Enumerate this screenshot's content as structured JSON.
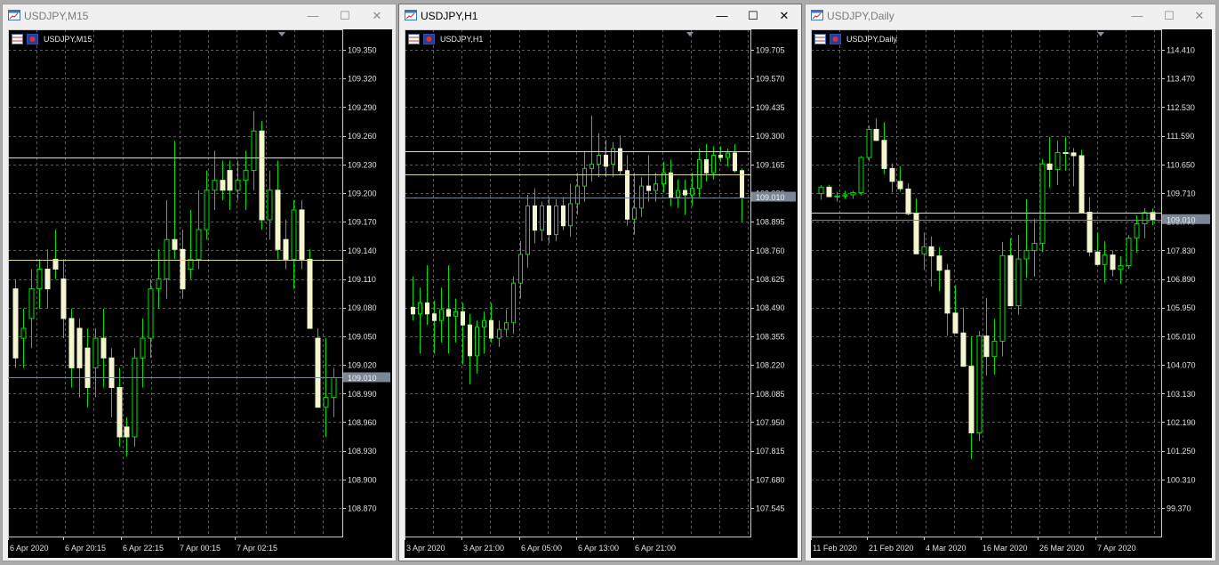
{
  "windows": [
    {
      "title": "USDJPY,M15",
      "label": "USDJPY,M15",
      "controls": {
        "minimize": "—",
        "maximize": "☐",
        "close": "✕"
      },
      "current_price": "109.010",
      "chart_data": {
        "type": "candlestick",
        "symbol": "USDJPY",
        "timeframe": "M15",
        "y_ticks": [
          "109.350",
          "109.320",
          "109.290",
          "109.260",
          "109.230",
          "109.200",
          "109.170",
          "109.140",
          "109.110",
          "109.080",
          "109.050",
          "109.020",
          "108.990",
          "108.960",
          "108.930",
          "108.900",
          "108.870"
        ],
        "x_labels": [
          "6 Apr 2020",
          "6 Apr 20:15",
          "6 Apr 22:15",
          "7 Apr 00:15",
          "7 Apr 02:15"
        ],
        "ylim": [
          108.849,
          109.363
        ],
        "hlines": [
          109.233,
          109.129,
          109.01
        ],
        "grid": true,
        "candles": [
          [
            109.1,
            109.11,
            109.02,
            109.03
          ],
          [
            109.05,
            109.08,
            109.02,
            109.06
          ],
          [
            109.07,
            109.12,
            109.04,
            109.1
          ],
          [
            109.1,
            109.13,
            109.08,
            109.12
          ],
          [
            109.12,
            109.14,
            109.08,
            109.1
          ],
          [
            109.13,
            109.16,
            109.11,
            109.12
          ],
          [
            109.11,
            109.13,
            109.05,
            109.07
          ],
          [
            109.07,
            109.08,
            109.0,
            109.02
          ],
          [
            109.06,
            109.07,
            108.99,
            109.02
          ],
          [
            109.04,
            109.06,
            108.98,
            109.0
          ],
          [
            109.02,
            109.06,
            108.99,
            109.05
          ],
          [
            109.05,
            109.08,
            109.0,
            109.03
          ],
          [
            109.03,
            109.04,
            108.97,
            109.0
          ],
          [
            109.0,
            109.02,
            108.94,
            108.95
          ],
          [
            108.96,
            108.97,
            108.93,
            108.95
          ],
          [
            108.95,
            109.04,
            108.94,
            109.03
          ],
          [
            109.03,
            109.07,
            109.0,
            109.05
          ],
          [
            109.05,
            109.11,
            109.03,
            109.1
          ],
          [
            109.1,
            109.14,
            109.08,
            109.11
          ],
          [
            109.11,
            109.19,
            109.09,
            109.15
          ],
          [
            109.15,
            109.25,
            109.13,
            109.14
          ],
          [
            109.14,
            109.16,
            109.09,
            109.1
          ],
          [
            109.12,
            109.18,
            109.11,
            109.13
          ],
          [
            109.13,
            109.2,
            109.12,
            109.16
          ],
          [
            109.16,
            109.22,
            109.15,
            109.2
          ],
          [
            109.2,
            109.24,
            109.18,
            109.21
          ],
          [
            109.21,
            109.23,
            109.19,
            109.2
          ],
          [
            109.22,
            109.23,
            109.18,
            109.2
          ],
          [
            109.2,
            109.23,
            109.19,
            109.21
          ],
          [
            109.21,
            109.24,
            109.18,
            109.22
          ],
          [
            109.22,
            109.28,
            109.2,
            109.26
          ],
          [
            109.26,
            109.27,
            109.16,
            109.17
          ],
          [
            109.17,
            109.22,
            109.15,
            109.2
          ],
          [
            109.2,
            109.23,
            109.13,
            109.14
          ],
          [
            109.15,
            109.17,
            109.12,
            109.13
          ],
          [
            109.13,
            109.19,
            109.1,
            109.18
          ],
          [
            109.18,
            109.19,
            109.12,
            109.13
          ],
          [
            109.13,
            109.14,
            109.06,
            109.06
          ],
          [
            109.05,
            109.06,
            108.98,
            108.98
          ],
          [
            108.98,
            109.05,
            108.95,
            108.99
          ],
          [
            108.99,
            109.02,
            108.97,
            109.01
          ]
        ]
      }
    },
    {
      "title": "USDJPY,H1",
      "label": "USDJPY,H1",
      "controls": {
        "minimize": "—",
        "maximize": "☐",
        "close": "✕"
      },
      "current_price": "109.010",
      "chart_data": {
        "type": "candlestick",
        "symbol": "USDJPY",
        "timeframe": "H1",
        "y_ticks": [
          "109.705",
          "109.570",
          "109.435",
          "109.300",
          "109.165",
          "109.030",
          "108.895",
          "108.760",
          "108.625",
          "108.490",
          "108.355",
          "108.220",
          "108.085",
          "107.950",
          "107.815",
          "107.680",
          "107.545"
        ],
        "x_labels": [
          "3 Apr 2020",
          "3 Apr 21:00",
          "6 Apr 05:00",
          "6 Apr 13:00",
          "6 Apr 21:00"
        ],
        "ylim": [
          107.47,
          109.771
        ],
        "hlines": [
          109.219,
          109.114,
          109.01
        ],
        "grid": true,
        "candles": [
          [
            108.51,
            108.65,
            108.45,
            108.48
          ],
          [
            108.48,
            108.6,
            108.3,
            108.53
          ],
          [
            108.53,
            108.7,
            108.43,
            108.48
          ],
          [
            108.48,
            108.54,
            108.3,
            108.45
          ],
          [
            108.45,
            108.6,
            108.35,
            108.5
          ],
          [
            108.5,
            108.7,
            108.3,
            108.47
          ],
          [
            108.47,
            108.55,
            108.35,
            108.49
          ],
          [
            108.49,
            108.53,
            108.25,
            108.43
          ],
          [
            108.43,
            108.48,
            108.16,
            108.29
          ],
          [
            108.29,
            108.45,
            108.21,
            108.42
          ],
          [
            108.42,
            108.49,
            108.3,
            108.45
          ],
          [
            108.45,
            108.53,
            108.35,
            108.37
          ],
          [
            108.37,
            108.45,
            108.33,
            108.41
          ],
          [
            108.41,
            108.5,
            108.38,
            108.44
          ],
          [
            108.44,
            108.65,
            108.39,
            108.62
          ],
          [
            108.62,
            108.81,
            108.55,
            108.75
          ],
          [
            108.75,
            109.02,
            108.69,
            108.97
          ],
          [
            108.97,
            109.05,
            108.8,
            108.86
          ],
          [
            108.86,
            108.99,
            108.81,
            108.97
          ],
          [
            108.97,
            109.01,
            108.8,
            108.84
          ],
          [
            108.84,
            109.0,
            108.81,
            108.97
          ],
          [
            108.97,
            109.01,
            108.86,
            108.88
          ],
          [
            108.88,
            109.07,
            108.83,
            108.98
          ],
          [
            108.98,
            109.12,
            108.93,
            109.06
          ],
          [
            109.06,
            109.22,
            108.99,
            109.14
          ],
          [
            109.14,
            109.38,
            109.08,
            109.16
          ],
          [
            109.16,
            109.3,
            109.1,
            109.2
          ],
          [
            109.2,
            109.27,
            109.1,
            109.15
          ],
          [
            109.16,
            109.26,
            109.1,
            109.23
          ],
          [
            109.23,
            109.29,
            109.11,
            109.13
          ],
          [
            109.13,
            109.2,
            108.88,
            108.91
          ],
          [
            108.91,
            109.12,
            108.84,
            108.96
          ],
          [
            108.96,
            109.1,
            108.92,
            109.06
          ],
          [
            109.06,
            109.2,
            108.99,
            109.04
          ],
          [
            109.04,
            109.12,
            108.99,
            109.07
          ],
          [
            109.07,
            109.17,
            109.03,
            109.12
          ],
          [
            109.12,
            109.18,
            108.97,
            109.01
          ],
          [
            109.01,
            109.09,
            108.96,
            109.04
          ],
          [
            109.04,
            109.09,
            108.93,
            109.02
          ],
          [
            109.02,
            109.12,
            108.97,
            109.05
          ],
          [
            109.05,
            109.23,
            109.01,
            109.18
          ],
          [
            109.18,
            109.25,
            109.08,
            109.12
          ],
          [
            109.12,
            109.24,
            109.09,
            109.2
          ],
          [
            109.2,
            109.24,
            109.17,
            109.19
          ],
          [
            109.19,
            109.23,
            109.15,
            109.21
          ],
          [
            109.21,
            109.25,
            109.12,
            109.13
          ],
          [
            109.13,
            109.14,
            108.9,
            109.01
          ]
        ]
      }
    },
    {
      "title": "USDJPY,Daily",
      "label": "USDJPY,Daily",
      "controls": {
        "minimize": "—",
        "maximize": "☐",
        "close": "✕"
      },
      "current_price": "109.010",
      "chart_data": {
        "type": "candlestick",
        "symbol": "USDJPY",
        "timeframe": "Daily",
        "y_ticks": [
          "114.410",
          "113.470",
          "112.530",
          "111.590",
          "110.650",
          "109.710",
          "108.770",
          "107.830",
          "106.890",
          "105.950",
          "105.010",
          "104.070",
          "103.130",
          "102.190",
          "101.250",
          "100.310",
          "99.370"
        ],
        "x_labels": [
          "11 Feb 2020",
          "21 Feb 2020",
          "4 Mar 2020",
          "16 Mar 2020",
          "26 Mar 2020",
          "7 Apr 2020"
        ],
        "ylim": [
          98.64,
          115.233
        ],
        "hlines": [
          109.241,
          109.01
        ],
        "grid": true,
        "candles": [
          [
            109.86,
            110.13,
            109.66,
            110.07
          ],
          [
            110.07,
            110.15,
            109.87,
            109.76
          ],
          [
            109.76,
            109.92,
            109.6,
            109.78
          ],
          [
            109.78,
            109.95,
            109.7,
            109.82
          ],
          [
            109.82,
            109.95,
            109.69,
            109.89
          ],
          [
            109.89,
            111.09,
            109.8,
            111.04
          ],
          [
            111.04,
            112.08,
            110.91,
            111.96
          ],
          [
            111.96,
            112.33,
            111.58,
            111.6
          ],
          [
            111.6,
            112.2,
            110.5,
            110.68
          ],
          [
            110.68,
            110.85,
            109.9,
            110.26
          ],
          [
            110.26,
            110.75,
            109.92,
            110.02
          ],
          [
            110.01,
            110.2,
            109.15,
            109.2
          ],
          [
            109.2,
            109.7,
            108.0,
            107.89
          ],
          [
            107.89,
            108.59,
            107.36,
            108.12
          ],
          [
            108.12,
            108.45,
            106.82,
            107.82
          ],
          [
            107.82,
            108.11,
            106.67,
            107.35
          ],
          [
            107.35,
            107.56,
            105.21,
            105.95
          ],
          [
            105.95,
            106.86,
            105.44,
            105.3
          ],
          [
            105.3,
            106.13,
            104.5,
            104.21
          ],
          [
            104.21,
            105.17,
            101.18,
            102.03
          ],
          [
            102.03,
            105.36,
            101.77,
            105.2
          ],
          [
            105.2,
            106.44,
            103.9,
            104.53
          ],
          [
            104.53,
            105.76,
            103.94,
            105.03
          ],
          [
            105.03,
            108.28,
            104.53,
            107.83
          ],
          [
            107.83,
            108.4,
            106.41,
            106.19
          ],
          [
            106.19,
            108.5,
            105.9,
            107.72
          ],
          [
            107.72,
            109.68,
            107.1,
            108.0
          ],
          [
            108.0,
            109.04,
            107.14,
            108.23
          ],
          [
            108.23,
            111.0,
            107.95,
            110.83
          ],
          [
            110.83,
            111.71,
            110.05,
            110.65
          ],
          [
            110.65,
            111.59,
            110.14,
            111.2
          ],
          [
            111.2,
            111.73,
            110.6,
            111.19
          ],
          [
            111.19,
            111.35,
            110.1,
            111.1
          ],
          [
            111.1,
            111.29,
            109.8,
            109.25
          ],
          [
            109.25,
            109.75,
            107.8,
            107.95
          ],
          [
            107.95,
            108.58,
            107.54,
            107.54
          ],
          [
            107.54,
            108.3,
            106.95,
            107.85
          ],
          [
            107.85,
            108.0,
            107.15,
            107.38
          ],
          [
            107.38,
            107.81,
            106.92,
            107.5
          ],
          [
            107.5,
            108.5,
            107.4,
            108.4
          ],
          [
            108.4,
            109.15,
            107.92,
            108.87
          ],
          [
            108.87,
            109.38,
            108.4,
            109.24
          ],
          [
            109.24,
            109.37,
            108.82,
            109.01
          ]
        ]
      }
    }
  ]
}
